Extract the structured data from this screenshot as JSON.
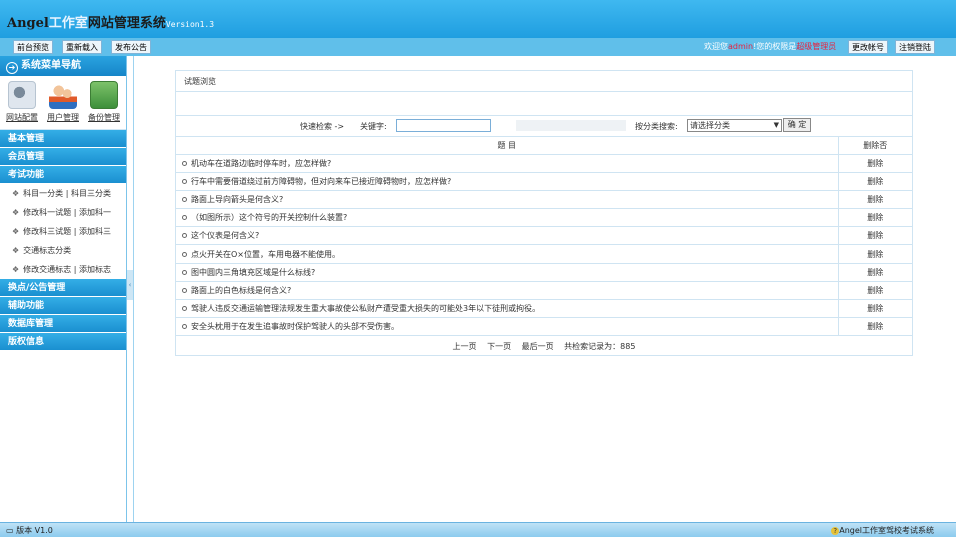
{
  "header": {
    "logo_part1": "Angel",
    "logo_part2": "工作室",
    "logo_part3": "网站管理系统",
    "logo_version": "Version1.3"
  },
  "toolbar": {
    "buttons": [
      "前台预览",
      "重新载入",
      "发布公告",
      "更改帐号",
      "注销登陆"
    ],
    "welcome_prefix": "欢迎您",
    "username": "admin",
    "welcome_mid": "!您的权限是",
    "role": "超级管理员"
  },
  "sidebar": {
    "title": "系统菜单导航",
    "tools": [
      "网站配置",
      "用户管理",
      "备份管理"
    ],
    "menu": [
      "基本管理",
      "会员管理",
      "考试功能"
    ],
    "exam_items": [
      [
        "科目一分类",
        "科目三分类"
      ],
      [
        "修改科一试题",
        "添加科一"
      ],
      [
        "修改科三试题",
        "添加科三"
      ],
      [
        "交通标志分类"
      ],
      [
        "修改交通标志",
        "添加标志"
      ]
    ],
    "menu_bottom": [
      "换点/公告管理",
      "辅助功能",
      "数据库管理",
      "版权信息"
    ]
  },
  "panel": {
    "title": "试题浏览",
    "quick_search": "快速检索 ->",
    "keyword_label": "关键字:",
    "category_label": "按分类搜索:",
    "category_selected": "请选择分类",
    "ok_button": "确 定",
    "col_question": "题 目",
    "col_delete": "删除否",
    "rows": [
      "机动车在道路边临时停车时，应怎样做?",
      "行车中需要借道绕过前方障碍物，但对向来车已接近障碍物时，应怎样做?",
      "路面上导向箭头是何含义?",
      "（如图所示）这个符号的开关控制什么装置?",
      "这个仪表是何含义?",
      "点火开关在O×位置，车用电器不能使用。",
      "图中圆内三角填充区域是什么标线?",
      "路面上的白色标线是何含义?",
      "驾驶人违反交通运输管理法规发生重大事故使公私财产遭受重大损失的可能处3年以下徒刑或拘役。",
      "安全头枕用于在发生追事故时保护驾驶人的头部不受伤害。"
    ],
    "delete_label": "删除",
    "pager": {
      "prev": "上一页",
      "next": "下一页",
      "last": "最后一页",
      "total": "共检索记录为：885"
    }
  },
  "footer": {
    "version": "版本 V1.0",
    "brand": "Angel工作室驾校考试系统"
  }
}
